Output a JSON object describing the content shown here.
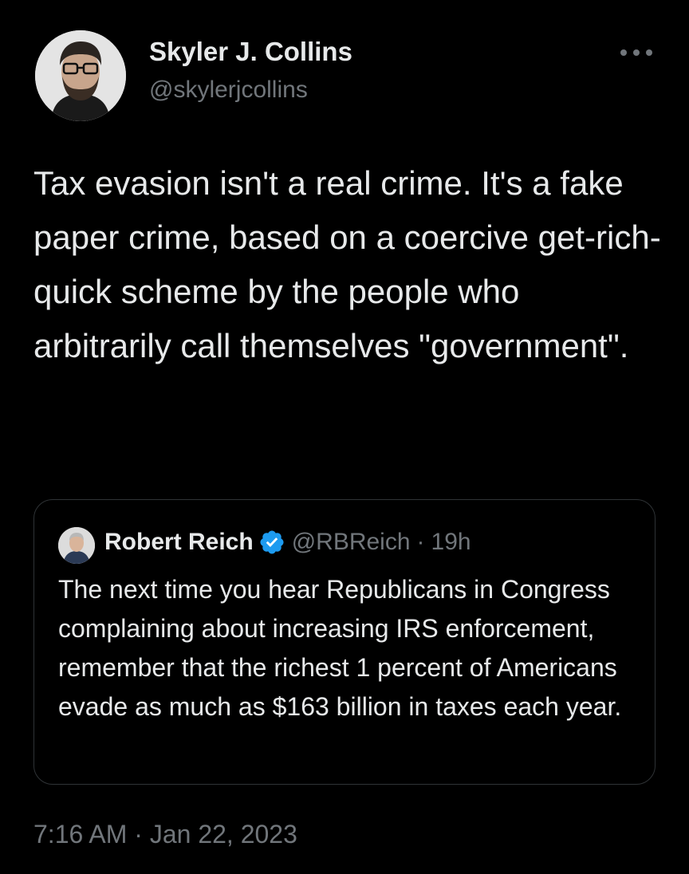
{
  "tweet": {
    "author": {
      "name": "Skyler J. Collins",
      "handle": "@skylerjcollins"
    },
    "more_icon": "more-horizontal-icon",
    "text": "Tax evasion isn't a real crime. It's a fake paper crime, based on a coercive get-rich-quick scheme by the people who arbitrarily call themselves \"government\".",
    "quoted": {
      "name": "Robert Reich",
      "verified_icon": "verified-badge-icon",
      "handle": "@RBReich",
      "separator": "·",
      "time": "19h",
      "text": "The next time you hear Republicans in Congress complaining about increasing IRS enforcement, remember that the richest 1 percent of Americans evade as much as $163 billion in taxes each year."
    },
    "timestamp": "7:16 AM · Jan 22, 2023"
  },
  "colors": {
    "background": "#000000",
    "primary_text": "#e7e9ea",
    "secondary_text": "#71767b",
    "border": "#2f3336",
    "verified": "#1d9bf0"
  }
}
